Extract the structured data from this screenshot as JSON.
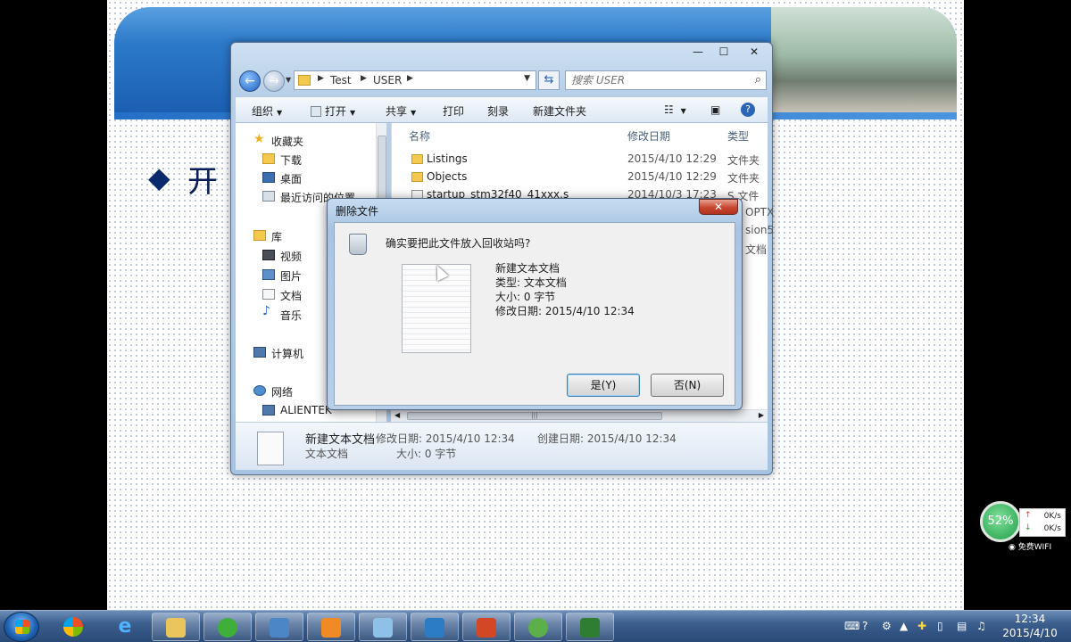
{
  "slide": {
    "bullet": "◆",
    "heading": "开"
  },
  "explorer": {
    "window_controls": {
      "minimize": "—",
      "maximize": "☐",
      "close": "✕"
    },
    "breadcrumb": [
      "Test",
      "USER"
    ],
    "search_placeholder": "搜索 USER",
    "toolbar": {
      "organize": "组织",
      "open": "打开",
      "share": "共享",
      "print": "打印",
      "burn": "刻录",
      "new_folder": "新建文件夹"
    },
    "nav": {
      "favorites": "收藏夹",
      "downloads": "下载",
      "desktop": "桌面",
      "recent": "最近访问的位置",
      "libraries": "库",
      "videos": "视频",
      "pictures": "图片",
      "documents": "文档",
      "music": "音乐",
      "computer": "计算机",
      "network": "网络",
      "alientek": "ALIENTEK"
    },
    "columns": {
      "name": "名称",
      "date": "修改日期",
      "type": "类型"
    },
    "files": [
      {
        "name": "Listings",
        "date": "2015/4/10 12:29",
        "type": "文件夹"
      },
      {
        "name": "Objects",
        "date": "2015/4/10 12:29",
        "type": "文件夹"
      },
      {
        "name": "startup_stm32f40_41xxx.s",
        "date": "2014/10/3 17:23",
        "type": "S 文件"
      },
      {
        "name": "",
        "date": "",
        "type": "OPTX"
      },
      {
        "name": "",
        "date": "",
        "type": "sion5"
      },
      {
        "name": "",
        "date": "",
        "type": "文档"
      }
    ],
    "details": {
      "name": "新建文本文档",
      "kind": "文本文档",
      "modified_label": "修改日期: 2015/4/10 12:34",
      "created_label": "创建日期: 2015/4/10 12:34",
      "size_label": "大小: 0 字节"
    }
  },
  "dialog": {
    "title": "删除文件",
    "close": "✕",
    "question": "确实要把此文件放入回收站吗?",
    "file_name": "新建文本文档",
    "file_type": "类型: 文本文档",
    "file_size": "大小: 0 字节",
    "file_modified": "修改日期: 2015/4/10 12:34",
    "yes_label": "是(Y)",
    "no_label": "否(N)"
  },
  "network_widget": {
    "percent": "52%",
    "up_speed": "0K/s",
    "down_speed": "0K/s",
    "wifi_label": "免费WIFI"
  },
  "taskbar": {
    "time": "12:34",
    "date": "2015/4/10",
    "apps": [
      {
        "icon": "folder-icon",
        "color": "#e9c55c"
      },
      {
        "icon": "green-refresh-icon",
        "color": "#3fae3b"
      },
      {
        "icon": "control-panel-icon",
        "color": "#4c86c6"
      },
      {
        "icon": "pdf-icon",
        "color": "#f08a24"
      },
      {
        "icon": "notes-icon",
        "color": "#8fc1e8"
      },
      {
        "icon": "bird-app-icon",
        "color": "#2c7cc4"
      },
      {
        "icon": "powerpoint-icon",
        "color": "#d24726"
      },
      {
        "icon": "green-disc-icon",
        "color": "#5bb04a"
      },
      {
        "icon": "v-app-icon",
        "color": "#2e7d32"
      }
    ]
  },
  "colors": {
    "accent": "#1f5fbf",
    "slide_title": "#0b1e55",
    "close_red": "#c7452e"
  }
}
